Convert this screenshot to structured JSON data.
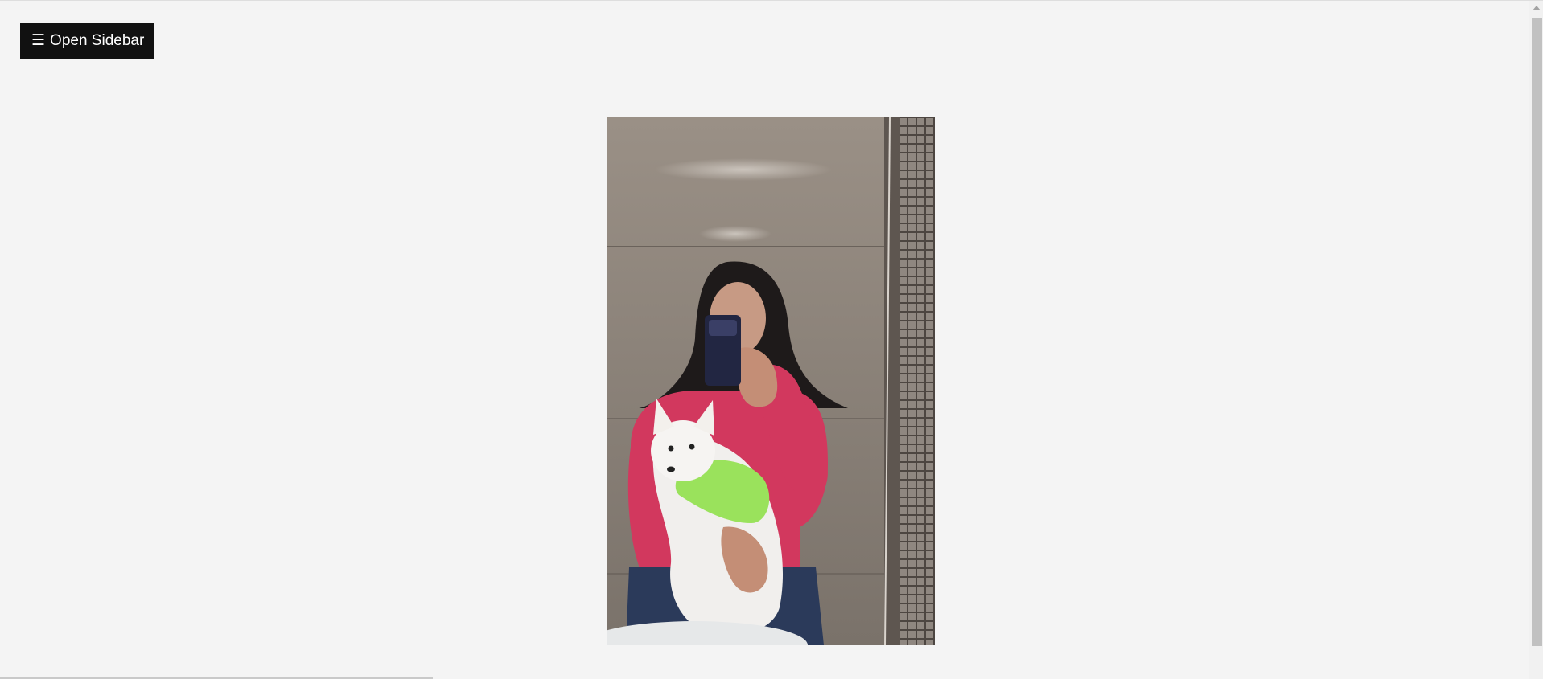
{
  "sidebar_button": {
    "icon": "hamburger-icon",
    "icon_glyph": "☰",
    "label": "Open Sidebar"
  },
  "main_image": {
    "description_icon": "photo-image"
  },
  "colors": {
    "page_background": "#f4f4f4",
    "button_background": "#111111",
    "button_text": "#ffffff",
    "scrollbar_thumb": "#c1c1c1"
  }
}
